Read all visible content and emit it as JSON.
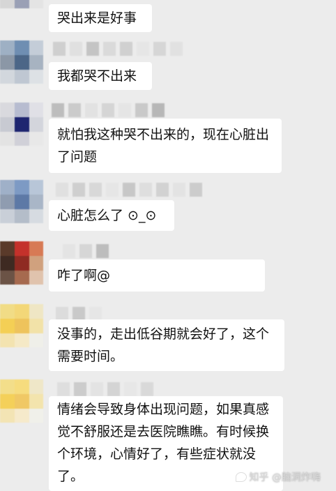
{
  "messages": [
    {
      "text": "哭出来是好事"
    },
    {
      "text": "我都哭不出来"
    },
    {
      "text": "就怕我这种哭不出来的，现在心脏出了问题"
    },
    {
      "text": "心脏怎么了 ⊙_⊙"
    },
    {
      "text": "咋了啊@"
    },
    {
      "text": "没事的，走出低谷期就会好了，这个需要时间。"
    },
    {
      "text": "情绪会导致身体出现问题，如果真感觉不舒服还是去医院瞧瞧。有时候换个环境，心情好了，有些症状就没了。"
    }
  ],
  "watermark": {
    "text": "知乎 @脑洞炸嗨"
  },
  "colors": {
    "background": "#ececec",
    "bubble": "#ffffff",
    "text": "#111111"
  }
}
